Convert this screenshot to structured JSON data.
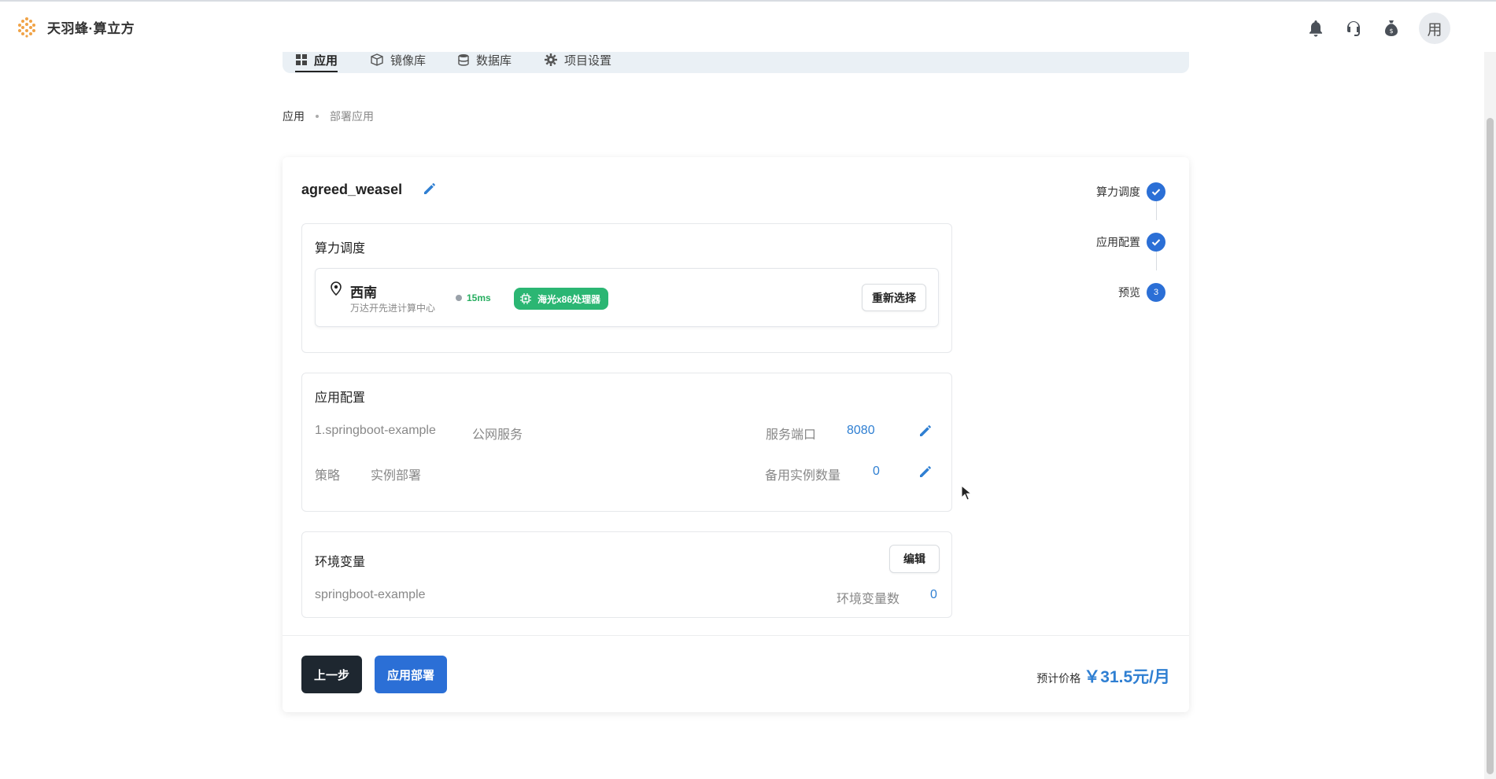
{
  "brand": {
    "name": "天羽蜂·算立方",
    "logo_color": "#f0a347"
  },
  "header": {
    "icons": [
      "bell-icon",
      "headset-icon",
      "money-bag-icon"
    ],
    "avatar_text": "用"
  },
  "tabs": [
    {
      "label": "应用",
      "icon": "grid-icon",
      "active": true
    },
    {
      "label": "镜像库",
      "icon": "box-icon",
      "active": false
    },
    {
      "label": "数据库",
      "icon": "database-icon",
      "active": false
    },
    {
      "label": "项目设置",
      "icon": "gear-icon",
      "active": false
    }
  ],
  "breadcrumb": {
    "root": "应用",
    "current": "部署应用"
  },
  "app": {
    "name": "agreed_weasel"
  },
  "compute": {
    "title": "算力调度",
    "region": "西南",
    "datacenter": "万达开先进计算中心",
    "latency": "15ms",
    "processor": "海光x86处理器",
    "reselect_label": "重新选择"
  },
  "config": {
    "title": "应用配置",
    "service_name": "1.springboot-example",
    "service_type": "公网服务",
    "port_label": "服务端口",
    "port_value": "8080",
    "strategy_label": "策略",
    "strategy_value": "实例部署",
    "backup_label": "备用实例数量",
    "backup_value": "0"
  },
  "env": {
    "title": "环境变量",
    "edit_label": "编辑",
    "app_name": "springboot-example",
    "count_label": "环境变量数",
    "count_value": "0"
  },
  "footer": {
    "prev_label": "上一步",
    "deploy_label": "应用部署",
    "price_label": "预计价格",
    "price_value": "￥31.5元/月"
  },
  "steps": [
    {
      "label": "算力调度",
      "status": "done",
      "number": ""
    },
    {
      "label": "应用配置",
      "status": "done",
      "number": ""
    },
    {
      "label": "预览",
      "status": "current",
      "number": "3"
    }
  ],
  "colors": {
    "primary": "#2b6fd6",
    "link": "#2f7fd2",
    "success": "#2bb673",
    "dark": "#1e2730"
  }
}
